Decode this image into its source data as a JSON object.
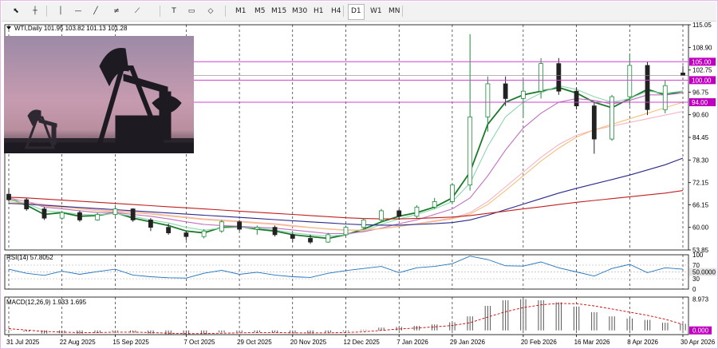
{
  "toolbar": {
    "tools": [
      {
        "name": "cursor-icon"
      },
      {
        "name": "crosshair-icon"
      },
      {
        "name": "vertical-line-icon"
      },
      {
        "name": "horizontal-line-icon"
      },
      {
        "name": "trendline-icon"
      },
      {
        "name": "equidistant-channel-icon"
      },
      {
        "name": "fibonacci-icon"
      },
      {
        "name": "text-icon"
      },
      {
        "name": "label-icon"
      },
      {
        "name": "shapes-icon"
      }
    ],
    "timeframes": [
      "M1",
      "M5",
      "M15",
      "M30",
      "H1",
      "H4",
      "D1",
      "W1",
      "MN"
    ],
    "active_timeframe": "D1"
  },
  "main_header": "WTI,Daily  101.95 103.82 101.13 101.28",
  "rsi_header": "RSI(14) 57.8052",
  "macd_header": "MACD(12,26,9) 1.933 1.695",
  "colors": {
    "bull": "#1e8c3a",
    "bear": "#222222",
    "rsi": "#1e73be",
    "macd_hist": "#555555",
    "macd_signal": "#d00000",
    "ma_fast": "#1a7a2a",
    "ma_2": "#8fd6b0",
    "ma_3": "#c070c0",
    "ma_4": "#f6b3c6",
    "ma_5": "#f4c07a",
    "ma_6": "#2a2a8a",
    "ma_7": "#c02020",
    "level_line": "#d040d0",
    "level_badge": "#c000c0",
    "grid": "#000000"
  },
  "chart_data": [
    {
      "type": "line",
      "title": "WTI,Daily",
      "ohlc_last": {
        "open": 101.95,
        "high": 103.82,
        "low": 101.13,
        "close": 101.28
      },
      "x_tick_labels": [
        "31 Jul 2025",
        "22 Aug 2025",
        "15 Sep 2025",
        "7 Oct 2025",
        "29 Oct 2025",
        "20 Nov 2025",
        "12 Dec 2025",
        "7 Jan 2026",
        "29 Jan 2026",
        "20 Feb 2026",
        "16 Mar 2026",
        "8 Apr 2026",
        "30 Apr 2026"
      ],
      "y_tick_labels": [
        "115.05",
        "108.90",
        "102.75",
        "96.75",
        "90.60",
        "84.45",
        "78.30",
        "72.15",
        "66.15",
        "60.00",
        "53.85"
      ],
      "ylim": [
        53.85,
        115.05
      ],
      "grid": true,
      "price_levels": [
        {
          "label": "105.00",
          "value": 105.0
        },
        {
          "label": "100.00",
          "value": 100.0
        },
        {
          "label": "94.00",
          "value": 94.0
        }
      ],
      "series": [
        {
          "color": "#1a7a2a",
          "values": [
            68.0,
            66.0,
            63.5,
            64.0,
            63.0,
            63.2,
            64.0,
            62.5,
            61.5,
            60.5,
            59.0,
            58.5,
            60.0,
            60.2,
            59.5,
            59.0,
            58.0,
            57.5,
            57.0,
            58.0,
            59.5,
            61.5,
            63.0,
            64.0,
            65.5,
            68.0,
            75.0,
            88.0,
            94.0,
            96.0,
            97.0,
            98.0,
            96.5,
            94.0,
            92.5,
            95.0,
            97.5,
            96.0,
            97.0
          ]
        },
        {
          "color": "#8fd6b0",
          "values": [
            67.5,
            66.5,
            64.5,
            64.2,
            63.5,
            63.4,
            63.8,
            63.0,
            62.0,
            61.2,
            60.0,
            59.2,
            59.8,
            60.0,
            59.8,
            59.3,
            58.5,
            58.0,
            57.6,
            58.0,
            59.0,
            60.8,
            62.3,
            63.5,
            65.0,
            67.0,
            72.0,
            82.0,
            90.0,
            94.0,
            96.5,
            98.5,
            97.5,
            95.5,
            94.0,
            95.0,
            97.0,
            96.5,
            97.0
          ]
        },
        {
          "color": "#c070c0",
          "values": [
            68.0,
            67.0,
            65.5,
            65.0,
            64.5,
            64.0,
            64.0,
            63.5,
            63.0,
            62.3,
            61.5,
            60.8,
            60.5,
            60.3,
            60.0,
            59.8,
            59.3,
            58.8,
            58.3,
            58.3,
            58.8,
            59.8,
            61.0,
            62.0,
            63.5,
            65.0,
            68.0,
            74.0,
            81.0,
            87.0,
            91.0,
            94.0,
            95.0,
            94.5,
            93.5,
            94.5,
            96.0,
            96.0,
            96.5
          ]
        },
        {
          "color": "#f6b3c6",
          "values": [
            67.8,
            67.0,
            66.2,
            65.8,
            65.3,
            64.8,
            64.5,
            64.2,
            63.8,
            63.3,
            62.8,
            62.3,
            62.0,
            61.7,
            61.3,
            61.0,
            60.5,
            60.0,
            59.6,
            59.3,
            59.3,
            59.7,
            60.3,
            61.0,
            61.8,
            62.5,
            64.0,
            67.0,
            71.0,
            75.0,
            79.0,
            82.5,
            85.0,
            86.5,
            87.5,
            88.5,
            89.5,
            90.5,
            91.5
          ]
        },
        {
          "color": "#f4c07a",
          "values": [
            67.0,
            66.4,
            65.8,
            65.4,
            65.0,
            64.5,
            64.2,
            64.0,
            63.6,
            63.1,
            62.6,
            62.1,
            61.8,
            61.5,
            61.1,
            60.8,
            60.3,
            59.9,
            59.5,
            59.2,
            59.2,
            59.6,
            60.2,
            60.9,
            61.6,
            62.3,
            63.6,
            66.2,
            70.0,
            74.0,
            78.0,
            81.5,
            84.5,
            86.5,
            88.0,
            89.5,
            91.0,
            92.5,
            94.0
          ]
        },
        {
          "color": "#2a2a8a",
          "values": [
            66.5,
            66.3,
            66.0,
            65.7,
            65.4,
            65.1,
            64.8,
            64.5,
            64.2,
            63.9,
            63.6,
            63.3,
            63.0,
            62.7,
            62.4,
            62.1,
            61.8,
            61.5,
            61.2,
            60.9,
            60.7,
            60.6,
            60.6,
            60.8,
            61.0,
            61.3,
            62.0,
            63.3,
            64.8,
            66.3,
            67.8,
            69.3,
            70.6,
            71.8,
            73.0,
            74.2,
            75.6,
            77.0,
            78.8
          ]
        },
        {
          "color": "#c02020",
          "values": [
            68.2,
            68.0,
            67.7,
            67.4,
            67.1,
            66.8,
            66.5,
            66.2,
            65.9,
            65.6,
            65.3,
            65.0,
            64.7,
            64.4,
            64.1,
            63.8,
            63.5,
            63.2,
            62.9,
            62.6,
            62.4,
            62.3,
            62.3,
            62.4,
            62.6,
            62.8,
            63.2,
            63.8,
            64.4,
            65.0,
            65.6,
            66.2,
            66.8,
            67.3,
            67.8,
            68.3,
            68.8,
            69.3,
            70.0
          ]
        }
      ],
      "candles_approx": [
        {
          "t": 0,
          "o": 69.0,
          "h": 70.5,
          "l": 67.0,
          "c": 67.5
        },
        {
          "t": 1,
          "o": 67.5,
          "h": 68.0,
          "l": 64.5,
          "c": 65.0
        },
        {
          "t": 2,
          "o": 65.0,
          "h": 65.5,
          "l": 62.0,
          "c": 62.5
        },
        {
          "t": 3,
          "o": 62.5,
          "h": 64.5,
          "l": 62.0,
          "c": 64.0
        },
        {
          "t": 4,
          "o": 64.0,
          "h": 64.5,
          "l": 61.5,
          "c": 62.0
        },
        {
          "t": 5,
          "o": 62.0,
          "h": 64.0,
          "l": 61.8,
          "c": 63.5
        },
        {
          "t": 6,
          "o": 63.5,
          "h": 66.0,
          "l": 63.0,
          "c": 65.0
        },
        {
          "t": 7,
          "o": 65.0,
          "h": 65.2,
          "l": 61.5,
          "c": 62.0
        },
        {
          "t": 8,
          "o": 62.0,
          "h": 62.5,
          "l": 59.0,
          "c": 60.0
        },
        {
          "t": 9,
          "o": 60.0,
          "h": 61.0,
          "l": 58.0,
          "c": 58.5
        },
        {
          "t": 10,
          "o": 58.5,
          "h": 59.0,
          "l": 56.5,
          "c": 57.5
        },
        {
          "t": 11,
          "o": 57.5,
          "h": 59.5,
          "l": 57.0,
          "c": 59.0
        },
        {
          "t": 12,
          "o": 59.0,
          "h": 62.0,
          "l": 58.5,
          "c": 61.5
        },
        {
          "t": 13,
          "o": 61.5,
          "h": 62.0,
          "l": 59.0,
          "c": 59.5
        },
        {
          "t": 14,
          "o": 59.5,
          "h": 60.5,
          "l": 58.0,
          "c": 60.0
        },
        {
          "t": 15,
          "o": 60.0,
          "h": 60.5,
          "l": 57.5,
          "c": 58.0
        },
        {
          "t": 16,
          "o": 58.0,
          "h": 58.5,
          "l": 56.0,
          "c": 57.0
        },
        {
          "t": 17,
          "o": 57.0,
          "h": 58.0,
          "l": 55.5,
          "c": 56.0
        },
        {
          "t": 18,
          "o": 56.0,
          "h": 58.5,
          "l": 55.8,
          "c": 58.0
        },
        {
          "t": 19,
          "o": 58.0,
          "h": 60.5,
          "l": 57.5,
          "c": 60.0
        },
        {
          "t": 20,
          "o": 60.0,
          "h": 62.5,
          "l": 59.5,
          "c": 62.0
        },
        {
          "t": 21,
          "o": 62.0,
          "h": 65.0,
          "l": 61.5,
          "c": 64.5
        },
        {
          "t": 22,
          "o": 64.5,
          "h": 65.0,
          "l": 62.0,
          "c": 63.0
        },
        {
          "t": 23,
          "o": 63.0,
          "h": 66.0,
          "l": 62.5,
          "c": 65.5
        },
        {
          "t": 24,
          "o": 65.5,
          "h": 68.0,
          "l": 65.0,
          "c": 67.0
        },
        {
          "t": 25,
          "o": 67.0,
          "h": 72.0,
          "l": 66.5,
          "c": 71.5
        },
        {
          "t": 26,
          "o": 71.5,
          "h": 112.5,
          "l": 70.0,
          "c": 90.0
        },
        {
          "t": 27,
          "o": 90.0,
          "h": 101.0,
          "l": 86.0,
          "c": 99.0
        },
        {
          "t": 28,
          "o": 99.0,
          "h": 101.0,
          "l": 93.0,
          "c": 95.0
        },
        {
          "t": 29,
          "o": 95.0,
          "h": 100.0,
          "l": 90.0,
          "c": 97.0
        },
        {
          "t": 30,
          "o": 97.0,
          "h": 106.0,
          "l": 95.0,
          "c": 104.5
        },
        {
          "t": 31,
          "o": 104.5,
          "h": 106.0,
          "l": 96.0,
          "c": 97.0
        },
        {
          "t": 32,
          "o": 97.0,
          "h": 98.0,
          "l": 92.0,
          "c": 93.0
        },
        {
          "t": 33,
          "o": 93.0,
          "h": 94.0,
          "l": 80.0,
          "c": 84.0
        },
        {
          "t": 34,
          "o": 84.0,
          "h": 96.0,
          "l": 83.5,
          "c": 95.5
        },
        {
          "t": 35,
          "o": 95.5,
          "h": 107.0,
          "l": 93.0,
          "c": 104.0
        },
        {
          "t": 36,
          "o": 104.0,
          "h": 105.0,
          "l": 90.5,
          "c": 92.0
        },
        {
          "t": 37,
          "o": 92.0,
          "h": 100.0,
          "l": 91.0,
          "c": 98.5
        },
        {
          "t": 38,
          "o": 101.95,
          "h": 103.82,
          "l": 101.13,
          "c": 101.28
        }
      ]
    },
    {
      "type": "line",
      "title": "RSI(14) 57.8052",
      "y_tick_labels": [
        "100",
        "70",
        "50.0000",
        "30",
        "0"
      ],
      "ylim": [
        0,
        100
      ],
      "last_value": 57.8052,
      "values": [
        58,
        46,
        40,
        52,
        43,
        51,
        58,
        41,
        36,
        33,
        32,
        46,
        55,
        43,
        49,
        41,
        36,
        34,
        46,
        54,
        60,
        66,
        48,
        62,
        66,
        74,
        96,
        86,
        68,
        67,
        79,
        62,
        50,
        38,
        60,
        72,
        48,
        62,
        57.8
      ]
    },
    {
      "type": "bar",
      "title": "MACD(12,26,9) 1.933 1.695",
      "y_tick_labels": [
        "8.973",
        "0.000"
      ],
      "ylim": [
        -1.2,
        9.5
      ],
      "macd": [
        0.2,
        -0.4,
        -0.9,
        -0.8,
        -0.9,
        -0.7,
        -0.3,
        -0.6,
        -0.9,
        -1.1,
        -1.2,
        -1.0,
        -0.6,
        -0.5,
        -0.5,
        -0.6,
        -0.8,
        -0.9,
        -0.6,
        -0.3,
        0.2,
        0.8,
        1.0,
        1.3,
        1.7,
        2.3,
        4.0,
        7.0,
        8.6,
        8.9,
        8.6,
        8.0,
        6.8,
        5.2,
        4.0,
        3.4,
        3.0,
        2.2,
        1.9
      ],
      "signal": [
        0.5,
        0.1,
        -0.3,
        -0.5,
        -0.6,
        -0.6,
        -0.5,
        -0.5,
        -0.6,
        -0.8,
        -0.9,
        -0.9,
        -0.8,
        -0.7,
        -0.6,
        -0.6,
        -0.7,
        -0.7,
        -0.7,
        -0.6,
        -0.4,
        0.0,
        0.4,
        0.7,
        1.0,
        1.4,
        2.2,
        3.8,
        5.3,
        6.5,
        7.3,
        7.7,
        7.6,
        7.0,
        6.1,
        5.2,
        4.3,
        3.2,
        1.7
      ]
    }
  ]
}
